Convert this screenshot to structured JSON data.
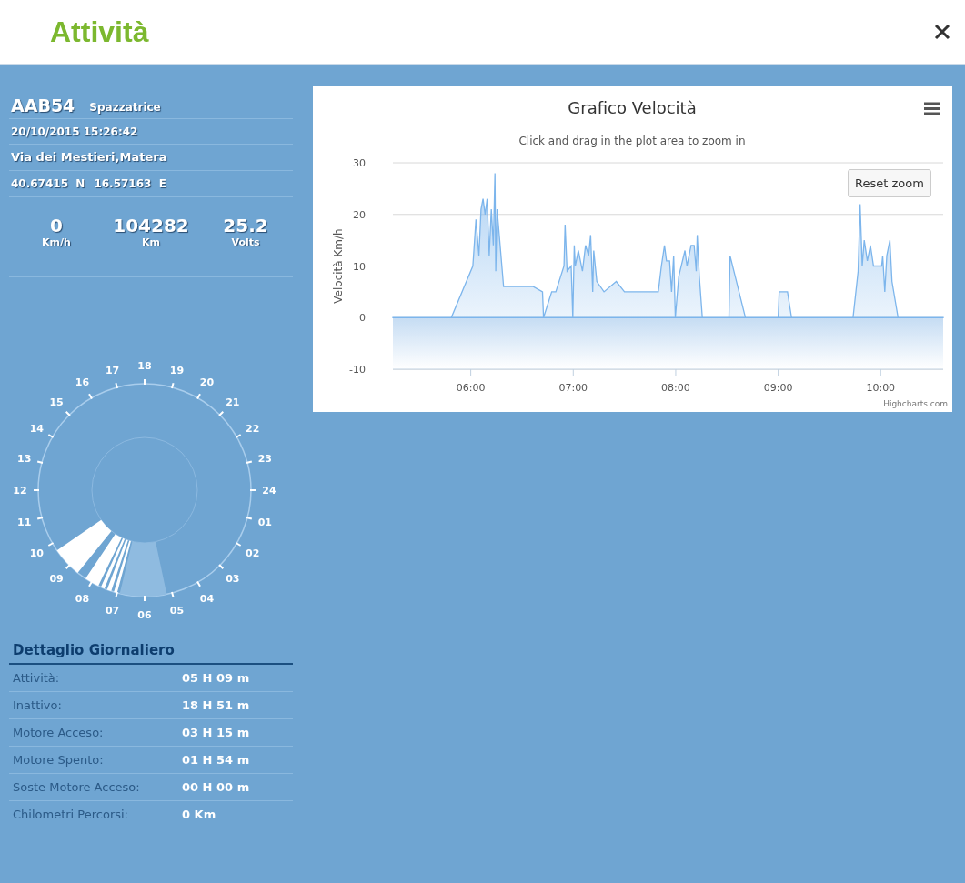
{
  "window": {
    "title": "Attività"
  },
  "vehicle": {
    "id": "AAB54",
    "type": "Spazzatrice",
    "timestamp": "20/10/2015 15:26:42",
    "address": "Via dei Mestieri,Matera",
    "latitude": "40.67415  N",
    "longitude": "16.57163  E"
  },
  "readings": [
    {
      "value": "0",
      "unit": "Km/h"
    },
    {
      "value": "104282",
      "unit": "Km"
    },
    {
      "value": "25.2",
      "unit": "Volts"
    }
  ],
  "clock": {
    "hour_labels": [
      "18",
      "17",
      "19",
      "16",
      "20",
      "15",
      "21",
      "14",
      "22",
      "13",
      "23",
      "12",
      "24",
      "11",
      "01",
      "10",
      "02",
      "09",
      "03",
      "08",
      "04",
      "07",
      "05",
      "06"
    ]
  },
  "daily_detail": {
    "title": "Dettaglio Giornaliero",
    "rows": [
      {
        "label": "Attività:",
        "value": "05 H 09 m"
      },
      {
        "label": "Inattivo:",
        "value": "18 H 51 m"
      },
      {
        "label": "Motore Acceso:",
        "value": "03 H 15 m"
      },
      {
        "label": "Motore Spento:",
        "value": "01 H 54 m"
      },
      {
        "label": "Soste Motore Acceso:",
        "value": "00 H 00 m"
      },
      {
        "label": "Chilometri Percorsi:",
        "value": "0 Km"
      }
    ]
  },
  "chart": {
    "subtitle": "Click and drag in the plot area to zoom in",
    "reset_button": "Reset zoom",
    "credit": "Highcharts.com",
    "chart_data": {
      "type": "area",
      "title": "Grafico Velocità",
      "ylabel": "Velocità Km/h",
      "x": [
        5.24,
        5.81,
        6.02,
        6.05,
        6.08,
        6.1,
        6.12,
        6.14,
        6.16,
        6.18,
        6.2,
        6.22,
        6.236,
        6.244,
        6.256,
        6.27,
        6.32,
        6.61,
        6.7,
        6.71,
        6.79,
        6.83,
        6.91,
        6.92,
        6.94,
        6.98,
        6.996,
        7.01,
        7.02,
        7.05,
        7.09,
        7.12,
        7.15,
        7.17,
        7.19,
        7.2,
        7.23,
        7.3,
        7.42,
        7.5,
        7.83,
        7.86,
        7.89,
        7.91,
        7.94,
        7.96,
        7.98,
        7.996,
        8.03,
        8.09,
        8.11,
        8.15,
        8.18,
        8.2,
        8.21,
        8.23,
        8.26,
        8.52,
        8.53,
        8.68,
        9.0,
        9.01,
        9.09,
        9.13,
        9.73,
        9.78,
        9.8,
        9.82,
        9.84,
        9.87,
        9.9,
        9.93,
        10.01,
        10.02,
        10.04,
        10.06,
        10.09,
        10.11,
        10.17,
        10.61
      ],
      "series": [
        {
          "color": "#7cb5ec",
          "values": [
            0,
            0,
            10,
            19,
            12,
            21,
            23,
            20,
            23,
            12,
            21,
            14,
            28,
            9,
            21,
            18,
            6,
            6,
            5,
            0,
            5,
            5,
            10,
            18,
            9,
            10,
            0,
            14,
            10,
            13,
            9,
            14,
            12,
            16,
            5,
            13,
            7,
            5,
            7,
            5,
            5,
            10,
            14,
            11,
            11,
            5,
            12,
            0,
            8,
            13,
            10,
            14,
            14,
            9,
            16,
            8,
            0,
            0,
            12,
            0,
            0,
            5,
            5,
            0,
            0,
            9,
            22,
            10,
            15,
            11,
            14,
            10,
            10,
            12,
            5,
            12,
            15,
            7,
            0,
            0
          ]
        }
      ],
      "xlim": [
        5.24,
        10.61
      ],
      "ylim": [
        -10,
        30
      ],
      "yticks": [
        -10,
        0,
        10,
        20,
        30
      ],
      "xticks": [
        {
          "value": 6,
          "label": "06:00"
        },
        {
          "value": 7,
          "label": "07:00"
        },
        {
          "value": 8,
          "label": "08:00"
        },
        {
          "value": 9,
          "label": "09:00"
        },
        {
          "value": 10,
          "label": "10:00"
        }
      ]
    }
  }
}
